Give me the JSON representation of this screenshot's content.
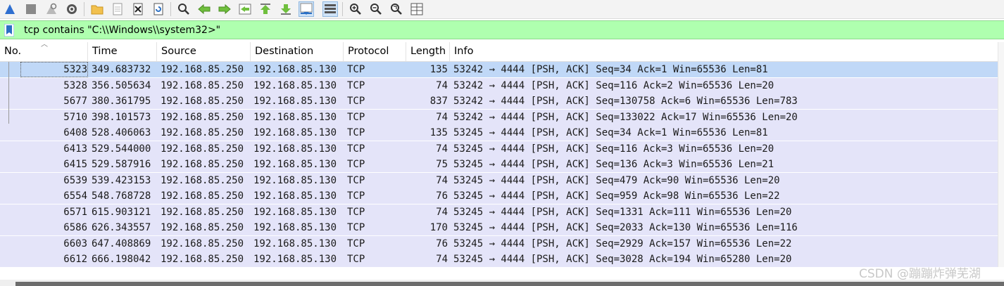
{
  "filter": {
    "text": "tcp contains \"C:\\\\Windows\\\\system32>\""
  },
  "columns": [
    "No.",
    "Time",
    "Source",
    "Destination",
    "Protocol",
    "Length",
    "Info"
  ],
  "packets": [
    {
      "no": "5323",
      "time": "349.683732",
      "src": "192.168.85.250",
      "dst": "192.168.85.130",
      "proto": "TCP",
      "len": "135",
      "info": "53242 → 4444 [PSH, ACK] Seq=34 Ack=1 Win=65536 Len=81"
    },
    {
      "no": "5328",
      "time": "356.505634",
      "src": "192.168.85.250",
      "dst": "192.168.85.130",
      "proto": "TCP",
      "len": "74",
      "info": "53242 → 4444 [PSH, ACK] Seq=116 Ack=2 Win=65536 Len=20"
    },
    {
      "no": "5677",
      "time": "380.361795",
      "src": "192.168.85.250",
      "dst": "192.168.85.130",
      "proto": "TCP",
      "len": "837",
      "info": "53242 → 4444 [PSH, ACK] Seq=130758 Ack=6 Win=65536 Len=783"
    },
    {
      "no": "5710",
      "time": "398.101573",
      "src": "192.168.85.250",
      "dst": "192.168.85.130",
      "proto": "TCP",
      "len": "74",
      "info": "53242 → 4444 [PSH, ACK] Seq=133022 Ack=17 Win=65536 Len=20"
    },
    {
      "no": "6408",
      "time": "528.406063",
      "src": "192.168.85.250",
      "dst": "192.168.85.130",
      "proto": "TCP",
      "len": "135",
      "info": "53245 → 4444 [PSH, ACK] Seq=34 Ack=1 Win=65536 Len=81"
    },
    {
      "no": "6413",
      "time": "529.544000",
      "src": "192.168.85.250",
      "dst": "192.168.85.130",
      "proto": "TCP",
      "len": "74",
      "info": "53245 → 4444 [PSH, ACK] Seq=116 Ack=3 Win=65536 Len=20"
    },
    {
      "no": "6415",
      "time": "529.587916",
      "src": "192.168.85.250",
      "dst": "192.168.85.130",
      "proto": "TCP",
      "len": "75",
      "info": "53245 → 4444 [PSH, ACK] Seq=136 Ack=3 Win=65536 Len=21"
    },
    {
      "no": "6539",
      "time": "539.423153",
      "src": "192.168.85.250",
      "dst": "192.168.85.130",
      "proto": "TCP",
      "len": "74",
      "info": "53245 → 4444 [PSH, ACK] Seq=479 Ack=90 Win=65536 Len=20"
    },
    {
      "no": "6554",
      "time": "548.768728",
      "src": "192.168.85.250",
      "dst": "192.168.85.130",
      "proto": "TCP",
      "len": "76",
      "info": "53245 → 4444 [PSH, ACK] Seq=959 Ack=98 Win=65536 Len=22"
    },
    {
      "no": "6571",
      "time": "615.903121",
      "src": "192.168.85.250",
      "dst": "192.168.85.130",
      "proto": "TCP",
      "len": "74",
      "info": "53245 → 4444 [PSH, ACK] Seq=1331 Ack=111 Win=65536 Len=20"
    },
    {
      "no": "6586",
      "time": "626.343557",
      "src": "192.168.85.250",
      "dst": "192.168.85.130",
      "proto": "TCP",
      "len": "170",
      "info": "53245 → 4444 [PSH, ACK] Seq=2033 Ack=130 Win=65536 Len=116"
    },
    {
      "no": "6603",
      "time": "647.408869",
      "src": "192.168.85.250",
      "dst": "192.168.85.130",
      "proto": "TCP",
      "len": "76",
      "info": "53245 → 4444 [PSH, ACK] Seq=2929 Ack=157 Win=65536 Len=22"
    },
    {
      "no": "6612",
      "time": "666.198042",
      "src": "192.168.85.250",
      "dst": "192.168.85.130",
      "proto": "TCP",
      "len": "74",
      "info": "53245 → 4444 [PSH, ACK] Seq=3028 Ack=194 Win=65280 Len=20"
    }
  ],
  "selected_index": 0,
  "watermark": "CSDN @蹦蹦炸弹芜湖",
  "colors": {
    "filter_valid": "#afffaf",
    "row_tcp": "#e4e4f9",
    "row_selected": "#c0d8f7"
  },
  "toolbar_icons": [
    "shark-fin-start-icon",
    "stop-square-icon",
    "restart-fin-icon",
    "capture-options-gear-icon",
    "open-folder-icon",
    "save-file-icon",
    "close-file-icon",
    "reload-file-icon",
    "find-packet-icon",
    "go-back-arrow-icon",
    "go-forward-arrow-icon",
    "go-to-packet-icon",
    "first-packet-icon",
    "last-packet-icon",
    "autoscroll-icon",
    "colorize-icon",
    "zoom-in-icon",
    "zoom-out-icon",
    "normal-size-icon",
    "resize-columns-icon"
  ]
}
